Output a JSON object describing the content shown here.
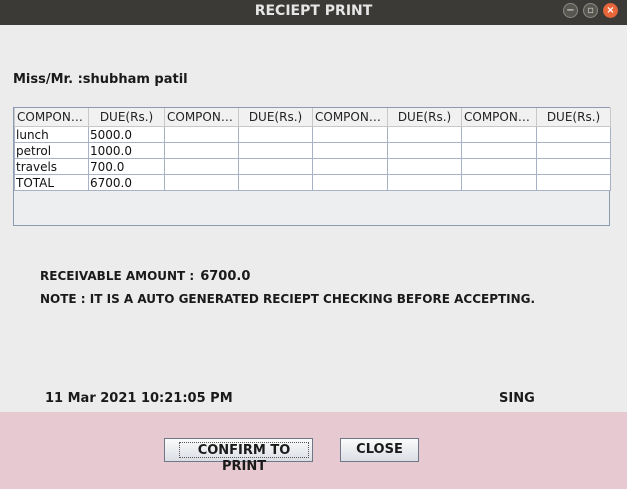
{
  "window": {
    "title": "RECIEPT PRINT"
  },
  "customer": {
    "label": "Miss/Mr. :shubham patil"
  },
  "table": {
    "headers": [
      "COMPONE...",
      "DUE(Rs.)",
      "COMPONE...",
      "DUE(Rs.)",
      "COMPONE...",
      "DUE(Rs.)",
      "COMPONE...",
      "DUE(Rs.)"
    ],
    "rows": [
      [
        "lunch",
        "5000.0",
        "",
        "",
        "",
        "",
        "",
        ""
      ],
      [
        "petrol",
        "1000.0",
        "",
        "",
        "",
        "",
        "",
        ""
      ],
      [
        "travels",
        "700.0",
        "",
        "",
        "",
        "",
        "",
        ""
      ],
      [
        "TOTAL",
        "6700.0",
        "",
        "",
        "",
        "",
        "",
        ""
      ]
    ]
  },
  "receivable": {
    "label": "RECEIVABLE AMOUNT :",
    "amount": "6700.0"
  },
  "note": "NOTE : IT IS A AUTO GENERATED RECIEPT CHECKING BEFORE ACCEPTING.",
  "footer": {
    "datetime": "11 Mar 2021 10:21:05 PM",
    "sign": "SING"
  },
  "buttons": {
    "confirm": "CONFIRM TO PRINT",
    "close": "CLOSE"
  },
  "colors": {
    "titlebar": "#3b3a36",
    "close_button": "#e9653a",
    "bottom_panel": "#e7c9d1"
  }
}
